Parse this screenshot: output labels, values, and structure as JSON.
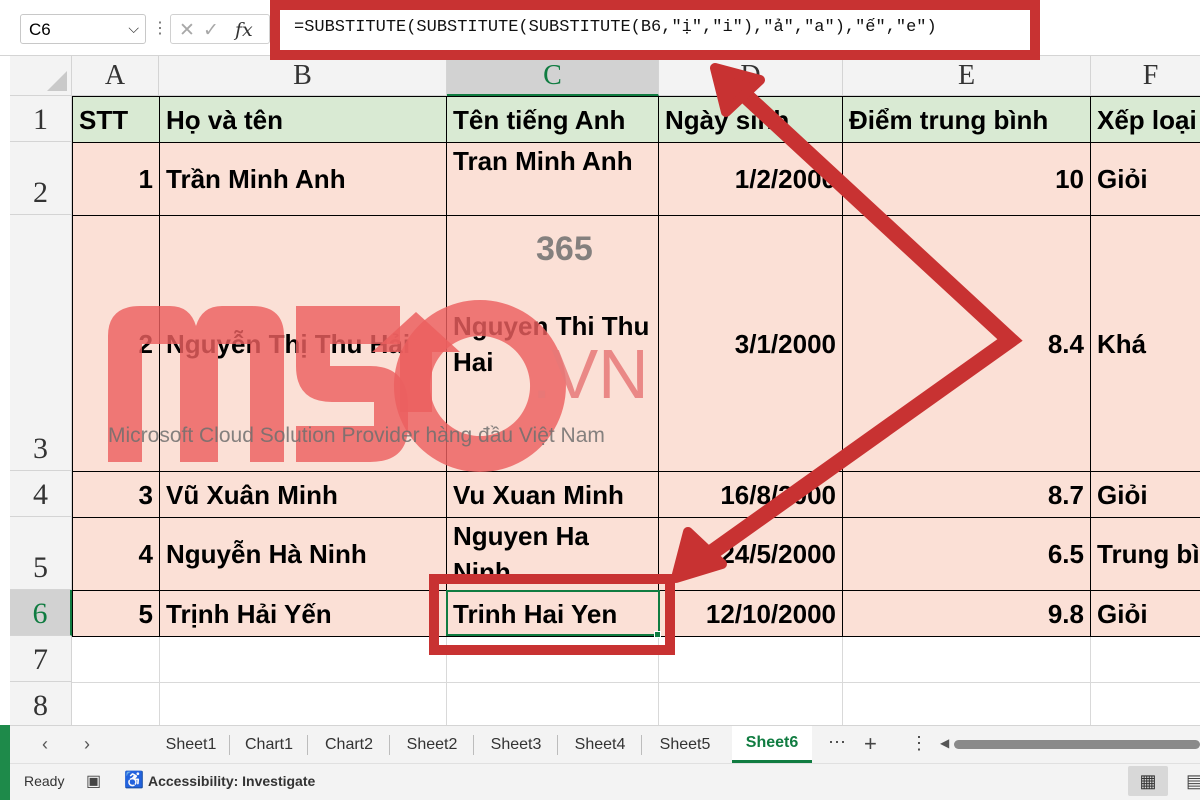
{
  "formula_bar": {
    "name_box": "C6",
    "name_box_chevron": "chevron-down-icon",
    "dots": "⋮",
    "cancel_icon": "✕",
    "enter_icon": "✓",
    "fx_label": "fx",
    "formula": "=SUBSTITUTE(SUBSTITUTE(SUBSTITUTE(B6,\"ị\",\"i\"),\"ả\",\"a\"),\"ế\",\"e\")"
  },
  "columns": [
    "A",
    "B",
    "C",
    "D",
    "E",
    "F"
  ],
  "row_numbers": [
    "1",
    "2",
    "3",
    "4",
    "5",
    "6",
    "7",
    "8"
  ],
  "header_row": [
    "STT",
    "Họ và tên",
    "Tên tiếng Anh",
    "Ngày sinh",
    "Điểm trung bình",
    "Xếp loại"
  ],
  "rows": [
    {
      "stt": "1",
      "name": "Trần Minh Anh",
      "english": "Tran Minh Anh",
      "dob": "1/2/2000",
      "score": "10",
      "grade": "Giỏi"
    },
    {
      "stt": "2",
      "name": "Nguyễn Thị Thu Hải",
      "english": "Nguyen Thi Thu Hai",
      "dob": "3/1/2000",
      "score": "8.4",
      "grade": "Khá"
    },
    {
      "stt": "3",
      "name": "Vũ Xuân Minh",
      "english": "Vu Xuan Minh",
      "dob": "16/8/2000",
      "score": "8.7",
      "grade": "Giỏi"
    },
    {
      "stt": "4",
      "name": "Nguyễn Hà Ninh",
      "english": "Nguyen Ha Ninh",
      "dob": "24/5/2000",
      "score": "6.5",
      "grade": "Trung bình"
    },
    {
      "stt": "5",
      "name": "Trịnh Hải Yến",
      "english": "Trinh Hai Yen",
      "dob": "12/10/2000",
      "score": "9.8",
      "grade": "Giỏi"
    }
  ],
  "watermark": {
    "logo_text": "MSO",
    "badge": "365",
    "domain": ".VN",
    "tagline": "Microsoft Cloud Solution Provider hàng đầu Việt Nam"
  },
  "sheet_tabs": {
    "prev": "‹",
    "next": "›",
    "tabs": [
      "Sheet1",
      "Chart1",
      "Chart2",
      "Sheet2",
      "Sheet3",
      "Sheet4",
      "Sheet5",
      "Sheet6"
    ],
    "active": "Sheet6",
    "more": "⋯",
    "add": "+",
    "options": "⋮",
    "scroll_left": "◀"
  },
  "status_bar": {
    "ready": "Ready",
    "macro_icon": "▣",
    "accessibility_icon": "♿",
    "accessibility": "Accessibility: Investigate",
    "normal_view_icon": "▦",
    "page_layout_icon": "▤"
  },
  "colors": {
    "header_fill": "#d9ead3",
    "row_fill": "#fbe0d6",
    "annotation_red": "#c83232",
    "excel_green": "#107c41"
  }
}
